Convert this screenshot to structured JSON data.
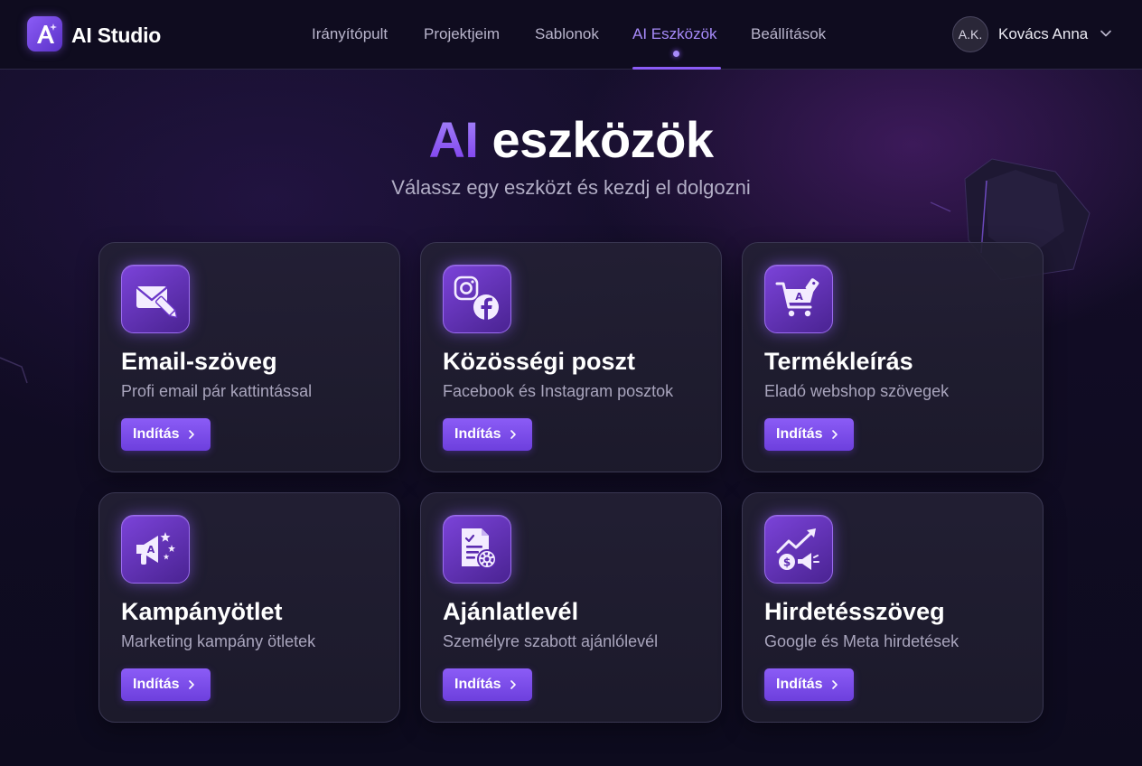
{
  "app": {
    "logo_text": "A",
    "title": "AI Studio"
  },
  "nav": {
    "items": [
      {
        "label": "Irányítópult",
        "active": false
      },
      {
        "label": "Projektjeim",
        "active": false
      },
      {
        "label": "Sablonok",
        "active": false
      },
      {
        "label": "AI Eszközök",
        "active": true
      },
      {
        "label": "Beállítások",
        "active": false
      }
    ]
  },
  "user": {
    "initials": "A.K.",
    "name": "Kovács Anna"
  },
  "hero": {
    "title_accent": "AI",
    "title_rest": " eszközök",
    "subtitle": "Válassz egy eszközt és kezdj el dolgozni"
  },
  "cards": [
    {
      "icon": "email-pen-icon",
      "title": "Email-szöveg",
      "description": "Profi email pár kattintással",
      "button": "Indítás"
    },
    {
      "icon": "social-media-icon",
      "title": "Közösségi poszt",
      "description": "Facebook és Instagram posztok",
      "button": "Indítás"
    },
    {
      "icon": "shopping-cart-icon",
      "title": "Termékleírás",
      "description": "Eladó webshop szövegek",
      "button": "Indítás"
    },
    {
      "icon": "megaphone-icon",
      "title": "Kampányötlet",
      "description": "Marketing kampány ötletek",
      "button": "Indítás"
    },
    {
      "icon": "document-gear-icon",
      "title": "Ajánlatlevél",
      "description": "Személyre szabott ajánlólevél",
      "button": "Indítás"
    },
    {
      "icon": "growth-megaphone-icon",
      "title": "Hirdetésszöveg",
      "description": "Google és Meta hirdetések",
      "button": "Indítás"
    }
  ],
  "colors": {
    "accent": "#8b5cf6",
    "accent_light": "#a78bfa",
    "background": "#110c24",
    "card_background": "#211e31"
  }
}
